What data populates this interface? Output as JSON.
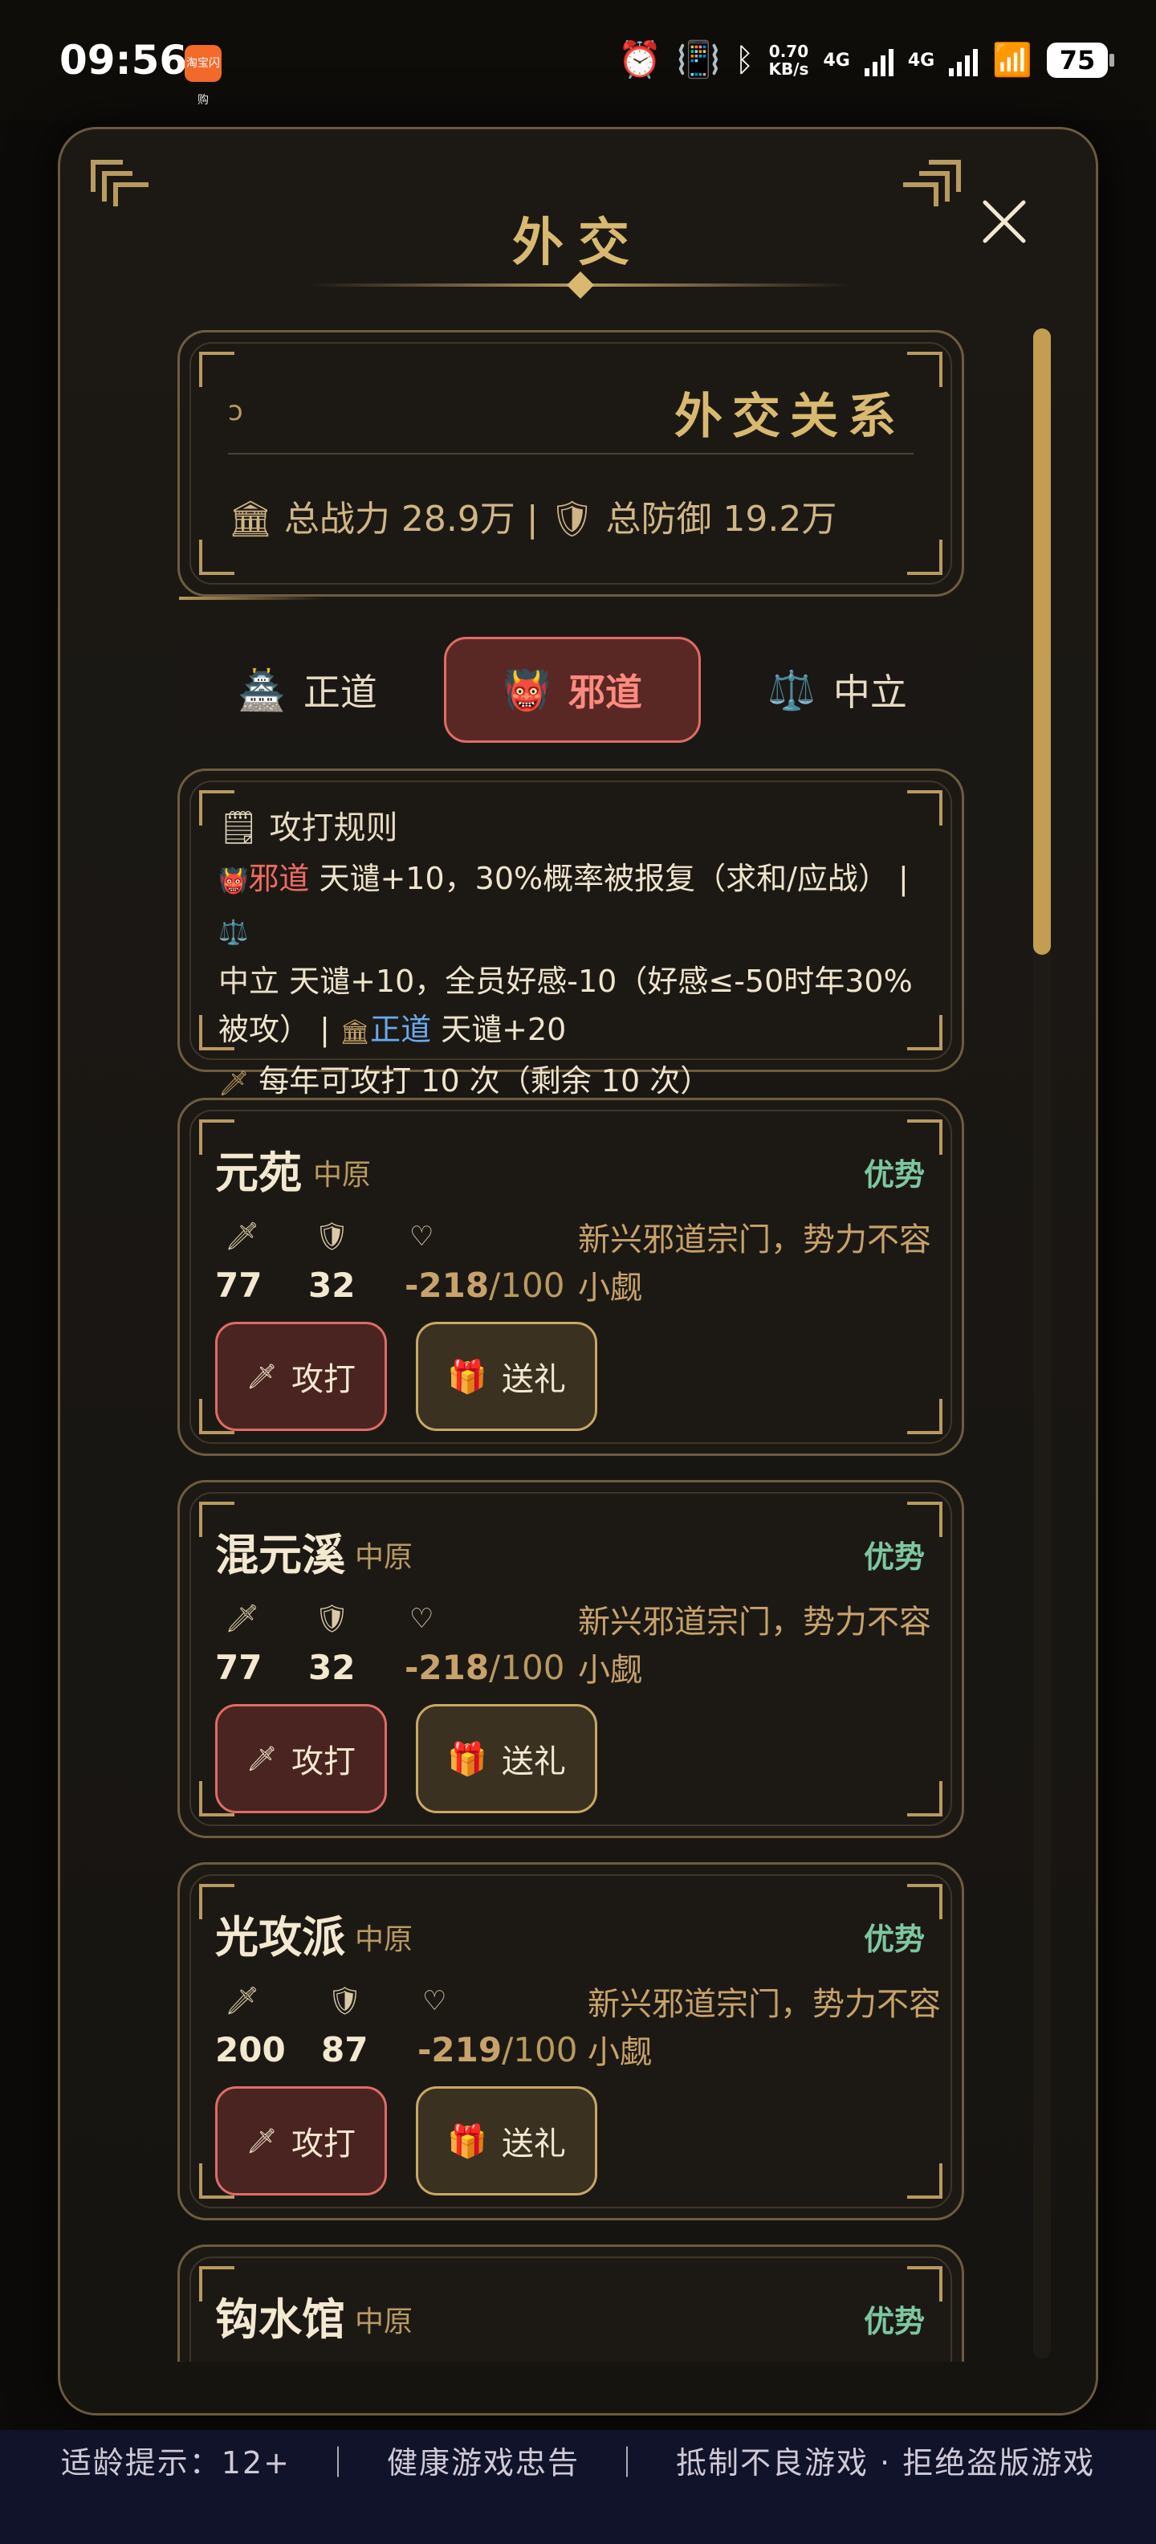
{
  "status_bar": {
    "time": "09:56",
    "app_icon_text": "淘宝闪购",
    "net_speed_value": "0.70",
    "net_speed_unit": "KB/s",
    "net_type_1": "4G",
    "net_type_2": "4G",
    "battery": "75",
    "icons": [
      "alarm-icon",
      "vibrate-icon",
      "bluetooth-icon",
      "signal-icon",
      "wifi-icon",
      "battery-icon"
    ]
  },
  "dialog": {
    "title": "外交",
    "close_icon": "close-icon"
  },
  "relation_header": {
    "title": "外交关系",
    "stats": "🏛 总战力 28.9万 | 🛡 总防御 19.2万"
  },
  "tabs": [
    {
      "emoji": "🏯",
      "label": "正道",
      "active": false
    },
    {
      "emoji": "👹",
      "label": "邪道",
      "active": true
    },
    {
      "emoji": "⚖️",
      "label": "中立",
      "active": false
    }
  ],
  "rules": {
    "title": "攻打规则",
    "evil_label": "邪道",
    "evil_text": " 天谴+10，30%概率被报复（求和/应战） | ",
    "neutral_label": "中立",
    "neutral_text": " 天谴+10，全员好感-10（好感≤-50时年30%被攻） | ",
    "righteous_label": "正道",
    "righteous_text": " 天谴+20",
    "limit_text": "每年可攻打 10 次（剩余 10 次）"
  },
  "sects": [
    {
      "name": "元苑",
      "region": "中原",
      "status": "优势",
      "attack": "77",
      "defense": "32",
      "favor": "-218",
      "favor_max": "/100",
      "desc": "新兴邪道宗门，势力不容小觑",
      "attack_btn": "攻打",
      "gift_btn": "送礼"
    },
    {
      "name": "混元溪",
      "region": "中原",
      "status": "优势",
      "attack": "77",
      "defense": "32",
      "favor": "-218",
      "favor_max": "/100",
      "desc": "新兴邪道宗门，势力不容小觑",
      "attack_btn": "攻打",
      "gift_btn": "送礼"
    },
    {
      "name": "光攻派",
      "region": "中原",
      "status": "优势",
      "attack": "200",
      "defense": "87",
      "favor": "-219",
      "favor_max": "/100",
      "desc": "新兴邪道宗门，势力不容小觑",
      "attack_btn": "攻打",
      "gift_btn": "送礼"
    },
    {
      "name": "钩水馆",
      "region": "中原",
      "status": "优势"
    }
  ],
  "footer": {
    "text": "适龄提示：12+　｜　健康游戏忠告　｜　抵制不良游戏 · 拒绝盗版游戏"
  }
}
